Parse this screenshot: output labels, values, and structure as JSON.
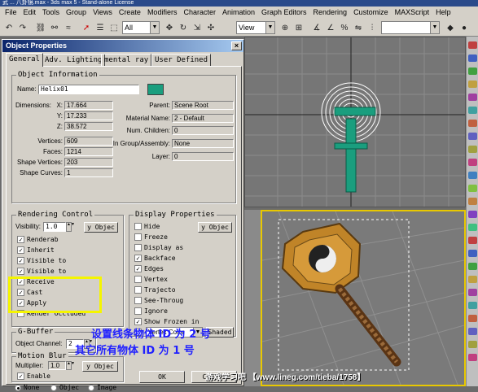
{
  "app": {
    "title": "武 ... 八卦镜.max - 3ds max 5 - Stand-alone License"
  },
  "menu": [
    "File",
    "Edit",
    "Tools",
    "Group",
    "Views",
    "Create",
    "Modifiers",
    "Character",
    "Animation",
    "Graph Editors",
    "Rendering",
    "Customize",
    "MAXScript",
    "Help"
  ],
  "toolbar": {
    "selection_filter": "All",
    "reference_coord": "View"
  },
  "dialog": {
    "title": "Object Properties",
    "tabs": [
      "General",
      "Adv. Lighting",
      "mental ray",
      "User Defined"
    ],
    "object_info": {
      "title": "Object Information",
      "name_label": "Name:",
      "name_value": "Helix01",
      "color": "#1a9e7e",
      "dims_label": "Dimensions:",
      "x_label": "X:",
      "x_value": "17.664",
      "y_label": "Y:",
      "y_value": "17.233",
      "z_label": "Z:",
      "z_value": "38.572",
      "vertices_label": "Vertices:",
      "vertices_value": "609",
      "faces_label": "Faces:",
      "faces_value": "1214",
      "shape_vertices_label": "Shape Vertices:",
      "shape_vertices_value": "203",
      "shape_curves_label": "Shape Curves:",
      "shape_curves_value": "1",
      "parent_label": "Parent:",
      "parent_value": "Scene Root",
      "material_label": "Material Name:",
      "material_value": "2 - Default",
      "children_label": "Num. Children:",
      "children_value": "0",
      "group_label": "In Group/Assembly:",
      "group_value": "None",
      "layer_label": "Layer:",
      "layer_value": "0"
    },
    "rendering_control": {
      "title": "Rendering Control",
      "visibility_label": "Visibility:",
      "visibility_value": "1.0",
      "by_object": "y Objec",
      "checks": [
        {
          "label": "Renderab",
          "checked": true
        },
        {
          "label": "Inherit",
          "checked": true
        },
        {
          "label": "Visible to",
          "checked": true
        },
        {
          "label": "Visible to",
          "checked": true
        },
        {
          "label": "Receive",
          "checked": true
        },
        {
          "label": "Cast",
          "checked": true
        },
        {
          "label": "Apply",
          "checked": true
        },
        {
          "label": "Render Occluded",
          "checked": false
        }
      ]
    },
    "display_properties": {
      "title": "Display Properties",
      "by_object": "y Objec",
      "checks": [
        {
          "label": "Hide",
          "checked": false
        },
        {
          "label": "Freeze",
          "checked": false
        },
        {
          "label": "Display as",
          "checked": false
        },
        {
          "label": "Backface",
          "checked": true
        },
        {
          "label": "Edges",
          "checked": true
        },
        {
          "label": "Vertex",
          "checked": false
        },
        {
          "label": "Trajecto",
          "checked": false
        },
        {
          "label": "See-Throug",
          "checked": false
        },
        {
          "label": "Ignore",
          "checked": false
        },
        {
          "label": "Show Frozen in",
          "checked": true
        }
      ],
      "vertex_color": "Vertex Color",
      "shaded": "Shaded"
    },
    "gbuffer": {
      "title": "G-Buffer",
      "channel_label": "Object Channel:",
      "channel_value": "2"
    },
    "motion_blur": {
      "title": "Motion Blur",
      "multiplier_label": "Multiplier:",
      "multiplier_value": "1.0",
      "by_object": "y Objec",
      "enable_label": "Enable",
      "radios": [
        "None",
        "Objec",
        "Image"
      ]
    },
    "ok": "OK",
    "cancel": "Cancel"
  },
  "annotations": {
    "line1": "设置线条物体 ID 为 2 号",
    "line2": "其它所有物体 ID 为 1 号"
  },
  "watermark": "游戏学习吧 【www.lineg.com/tieba/1758】",
  "colors": {
    "highlight": "#f5f500",
    "annotation": "#2020ff",
    "viewport_selection": "#e8c800"
  }
}
